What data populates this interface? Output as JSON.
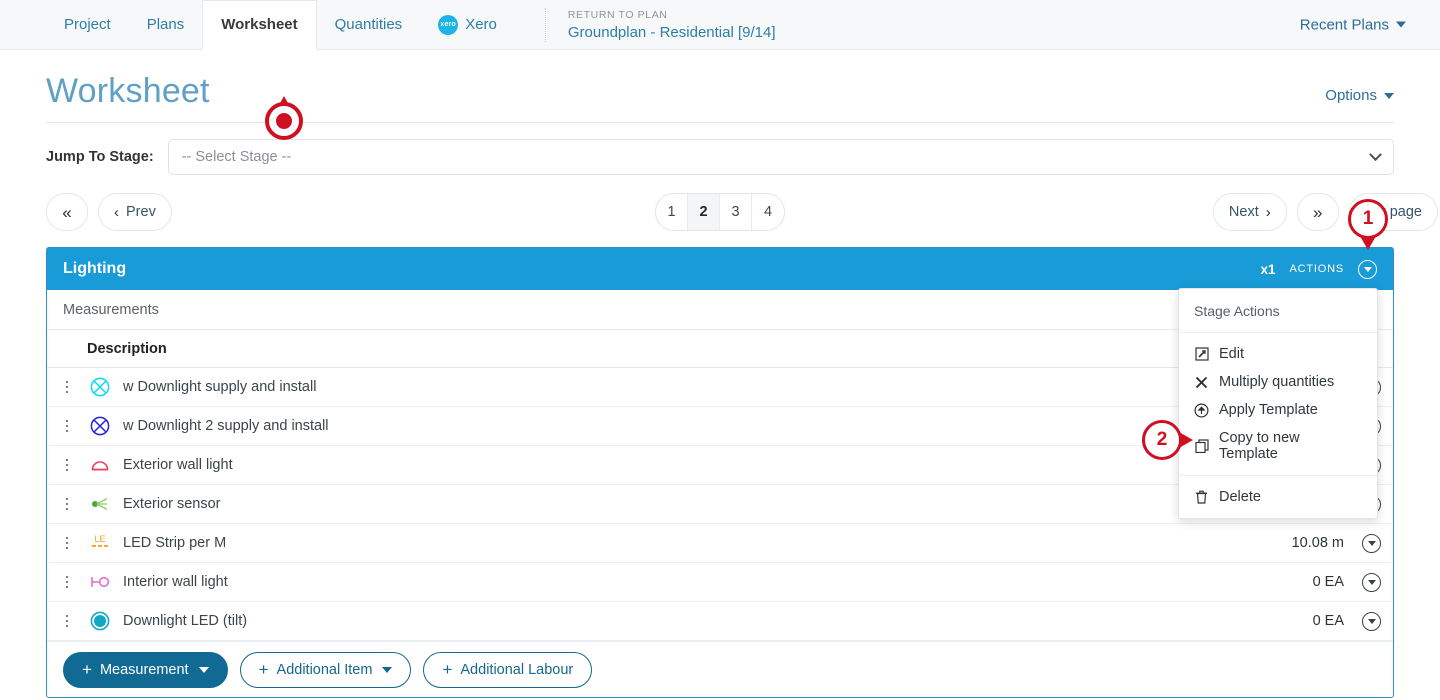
{
  "topnav": {
    "tabs": [
      {
        "label": "Project",
        "active": false,
        "icon": ""
      },
      {
        "label": "Plans",
        "active": false,
        "icon": ""
      },
      {
        "label": "Worksheet",
        "active": true,
        "icon": ""
      },
      {
        "label": "Quantities",
        "active": false,
        "icon": ""
      },
      {
        "label": "Xero",
        "active": false,
        "icon": "xero-logo-icon"
      }
    ],
    "xero_badge_text": "xero",
    "return_kicker": "RETURN TO PLAN",
    "plan_name": "Groundplan - Residential [9/14]",
    "recent_plans_label": "Recent Plans",
    "caret_icon": "chevron-down-icon"
  },
  "page": {
    "title": "Worksheet",
    "options_label": "Options",
    "options_caret_icon": "chevron-down-icon"
  },
  "jump": {
    "label": "Jump To Stage:",
    "selected": "-- Select Stage --",
    "placeholder": "-- Select Stage --",
    "chevron_icon": "chevron-down-icon"
  },
  "pager": {
    "first_icon": "double-chevron-left-icon",
    "prev_icon": "chevron-left-icon",
    "prev_label": "Prev",
    "pages": [
      "1",
      "2",
      "3",
      "4"
    ],
    "active_page": "2",
    "next_label": "Next",
    "next_icon": "chevron-right-icon",
    "last_icon": "double-chevron-right-icon",
    "per_page_label": "per page"
  },
  "stage_card": {
    "title": "Lighting",
    "multiplier": "x1",
    "actions_label": "ACTIONS",
    "actions_caret_icon": "circle-chevron-down-icon",
    "measurements_label": "Measurements",
    "column_headers": {
      "description": "Description"
    },
    "rows": [
      {
        "icon": "crossed-circle-cyan-icon",
        "icon_color": "#0fd8f5",
        "icon_type": "crossed-circle",
        "description": "w Downlight supply and install",
        "quantity": ""
      },
      {
        "icon": "crossed-circle-blue-icon",
        "icon_color": "#2222e0",
        "icon_type": "crossed-circle",
        "description": "w Downlight 2 supply and install",
        "quantity": ""
      },
      {
        "icon": "semicircle-red-icon",
        "icon_color": "#e8415c",
        "icon_type": "semicircle",
        "description": "Exterior wall light",
        "quantity": ""
      },
      {
        "icon": "sensor-green-icon",
        "icon_color": "#6cbf3f",
        "icon_type": "sensor",
        "description": "Exterior sensor",
        "quantity": ""
      },
      {
        "icon": "led-strip-icon",
        "icon_color": "#f0a020",
        "icon_type": "le-label",
        "icon_text": "LE",
        "description": "LED Strip per M",
        "quantity": "10.08 m"
      },
      {
        "icon": "wall-light-pink-icon",
        "icon_color": "#e36fd0",
        "icon_type": "wall-light",
        "description": "Interior wall light",
        "quantity": "0 EA"
      },
      {
        "icon": "filled-circle-teal-icon",
        "icon_color": "#11a8c8",
        "icon_type": "filled-circle",
        "description": "Downlight LED (tilt)",
        "quantity": "0 EA"
      }
    ],
    "row_caret_icon": "circle-chevron-down-icon",
    "drag_handle_icon": "drag-handle-dots-icon",
    "footer_buttons": [
      {
        "label": "Measurement",
        "style": "primary",
        "has_caret": true,
        "plus_icon": "plus-icon"
      },
      {
        "label": "Additional Item",
        "style": "outline",
        "has_caret": true,
        "plus_icon": "plus-icon"
      },
      {
        "label": "Additional Labour",
        "style": "outline",
        "has_caret": false,
        "plus_icon": "plus-icon"
      }
    ]
  },
  "stage_actions_menu": {
    "header": "Stage Actions",
    "groups": [
      {
        "items": [
          {
            "label": "Edit",
            "icon": "pencil-square-icon"
          },
          {
            "label": "Multiply quantities",
            "icon": "times-icon"
          },
          {
            "label": "Apply Template",
            "icon": "circle-arrow-up-icon"
          },
          {
            "label": "Copy to new Template",
            "icon": "copy-icon"
          }
        ]
      },
      {
        "items": [
          {
            "label": "Delete",
            "icon": "trash-icon"
          }
        ]
      }
    ]
  },
  "annotations": {
    "target_marker": {
      "name": "click-target-marker"
    },
    "markers": [
      {
        "number": "1",
        "direction": "down"
      },
      {
        "number": "2",
        "direction": "right"
      }
    ]
  },
  "colors": {
    "brand_blue": "#189bd7",
    "link_blue": "#2d7fa8",
    "title_blue": "#5fa0c4",
    "primary_button": "#106a93",
    "annotation_red": "#cf1020"
  }
}
